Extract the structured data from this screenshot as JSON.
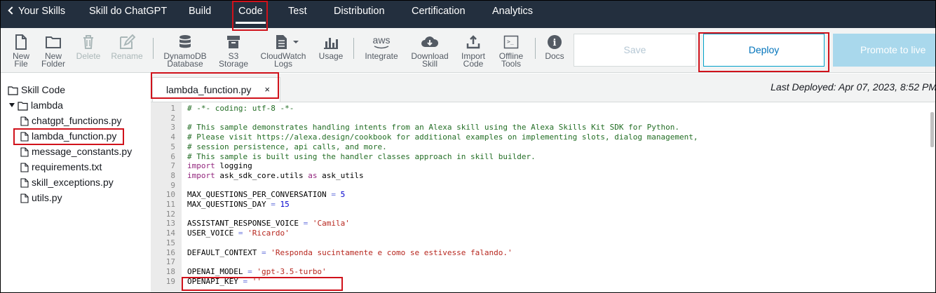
{
  "nav": {
    "back": "Your Skills",
    "skill_name": "Skill do ChatGPT",
    "items": [
      "Build",
      "Code",
      "Test",
      "Distribution",
      "Certification",
      "Analytics"
    ],
    "active": "Code"
  },
  "toolbar": {
    "tools": [
      {
        "label": "New\nFile",
        "icon": "new-file-icon",
        "enabled": true
      },
      {
        "label": "New\nFolder",
        "icon": "new-folder-icon",
        "enabled": true
      },
      {
        "label": "Delete",
        "icon": "trash-icon",
        "enabled": false
      },
      {
        "label": "Rename",
        "icon": "pencil-icon",
        "enabled": false
      },
      {
        "label": "DynamoDB\nDatabase",
        "icon": "database-icon",
        "enabled": true
      },
      {
        "label": "S3\nStorage",
        "icon": "bucket-icon",
        "enabled": true
      },
      {
        "label": "CloudWatch\nLogs",
        "icon": "document-dropdown-icon",
        "enabled": true
      },
      {
        "label": "Usage",
        "icon": "bar-chart-icon",
        "enabled": true
      },
      {
        "label": "Integrate",
        "icon": "aws-logo-icon",
        "icon_text": "aws",
        "enabled": true
      },
      {
        "label": "Download\nSkill",
        "icon": "cloud-download-icon",
        "enabled": true
      },
      {
        "label": "Import\nCode",
        "icon": "upload-icon",
        "enabled": true
      },
      {
        "label": "Offline\nTools",
        "icon": "terminal-icon",
        "icon_text": ">_",
        "enabled": true
      },
      {
        "label": "Docs",
        "icon": "info-icon",
        "icon_text": "i",
        "enabled": true
      }
    ],
    "save_label": "Save",
    "deploy_label": "Deploy",
    "promote_label": "Promote to live"
  },
  "tree": {
    "root": "Skill Code",
    "folder": "lambda",
    "files": [
      "chatgpt_functions.py",
      "lambda_function.py",
      "message_constants.py",
      "requirements.txt",
      "skill_exceptions.py",
      "utils.py"
    ]
  },
  "editor": {
    "tab_label": "lambda_function.py",
    "tab_close": "×",
    "last_deployed": "Last Deployed: Apr 07, 2023, 8:52 PM",
    "lines": [
      [
        [
          "comment",
          "# -*- coding: utf-8 -*-"
        ]
      ],
      [],
      [
        [
          "comment",
          "# This sample demonstrates handling intents from an Alexa skill using the Alexa Skills Kit SDK for Python."
        ]
      ],
      [
        [
          "comment",
          "# Please visit https://alexa.design/cookbook for additional examples on implementing slots, dialog management,"
        ]
      ],
      [
        [
          "comment",
          "# session persistence, api calls, and more."
        ]
      ],
      [
        [
          "comment",
          "# This sample is built using the handler classes approach in skill builder."
        ]
      ],
      [
        [
          "keyword",
          "import"
        ],
        [
          "plain",
          " logging"
        ]
      ],
      [
        [
          "keyword",
          "import"
        ],
        [
          "plain",
          " ask_sdk_core.utils "
        ],
        [
          "keyword",
          "as"
        ],
        [
          "plain",
          " ask_utils"
        ]
      ],
      [],
      [
        [
          "plain",
          "MAX_QUESTIONS_PER_CONVERSATION "
        ],
        [
          "op",
          "="
        ],
        [
          "plain",
          " "
        ],
        [
          "number",
          "5"
        ]
      ],
      [
        [
          "plain",
          "MAX_QUESTIONS_DAY "
        ],
        [
          "op",
          "="
        ],
        [
          "plain",
          " "
        ],
        [
          "number",
          "15"
        ]
      ],
      [],
      [
        [
          "plain",
          "ASSISTANT_RESPONSE_VOICE "
        ],
        [
          "op",
          "="
        ],
        [
          "plain",
          " "
        ],
        [
          "string",
          "'Camila'"
        ]
      ],
      [
        [
          "plain",
          "USER_VOICE "
        ],
        [
          "op",
          "="
        ],
        [
          "plain",
          " "
        ],
        [
          "string",
          "'Ricardo'"
        ]
      ],
      [],
      [
        [
          "plain",
          "DEFAULT_CONTEXT "
        ],
        [
          "op",
          "="
        ],
        [
          "plain",
          " "
        ],
        [
          "string",
          "'Responda sucintamente e como se estivesse falando.'"
        ]
      ],
      [],
      [
        [
          "plain",
          "OPENAI_MODEL "
        ],
        [
          "op",
          "="
        ],
        [
          "plain",
          " "
        ],
        [
          "string",
          "'gpt-3.5-turbo'"
        ]
      ],
      [
        [
          "plain",
          "OPENAPI_KEY "
        ],
        [
          "op",
          "="
        ],
        [
          "plain",
          " "
        ],
        [
          "string",
          "''"
        ]
      ]
    ]
  },
  "colors": {
    "nav_bg": "#232f3e",
    "toolbar_bg": "#f2f3f3",
    "accent": "#00a1c9",
    "highlight": "#d0121b"
  }
}
